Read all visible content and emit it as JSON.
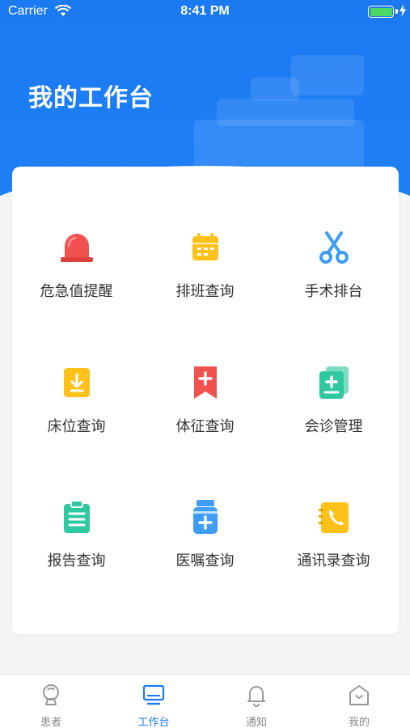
{
  "status_bar": {
    "carrier": "Carrier",
    "time": "8:41 PM"
  },
  "header": {
    "title": "我的工作台"
  },
  "colors": {
    "brand": "#1b7af2",
    "red": "#f2524f",
    "yellow": "#ffc21a",
    "blue": "#3f9df8",
    "teal": "#2fc8a0"
  },
  "tiles": [
    {
      "label": "危急值提醒",
      "icon": "alarm-icon"
    },
    {
      "label": "排班查询",
      "icon": "calendar-icon"
    },
    {
      "label": "手术排台",
      "icon": "scissors-icon"
    },
    {
      "label": "床位查询",
      "icon": "bed-download-icon"
    },
    {
      "label": "体征查询",
      "icon": "bookmark-plus-icon"
    },
    {
      "label": "会诊管理",
      "icon": "consult-icon"
    },
    {
      "label": "报告查询",
      "icon": "clipboard-icon"
    },
    {
      "label": "医嘱查询",
      "icon": "medicine-bottle-icon"
    },
    {
      "label": "通讯录查询",
      "icon": "phone-book-icon"
    }
  ],
  "tabs": [
    {
      "label": "患者",
      "icon": "patient-icon",
      "active": false
    },
    {
      "label": "工作台",
      "icon": "monitor-icon",
      "active": true
    },
    {
      "label": "通知",
      "icon": "bell-icon",
      "active": false
    },
    {
      "label": "我的",
      "icon": "home-icon",
      "active": false
    }
  ]
}
